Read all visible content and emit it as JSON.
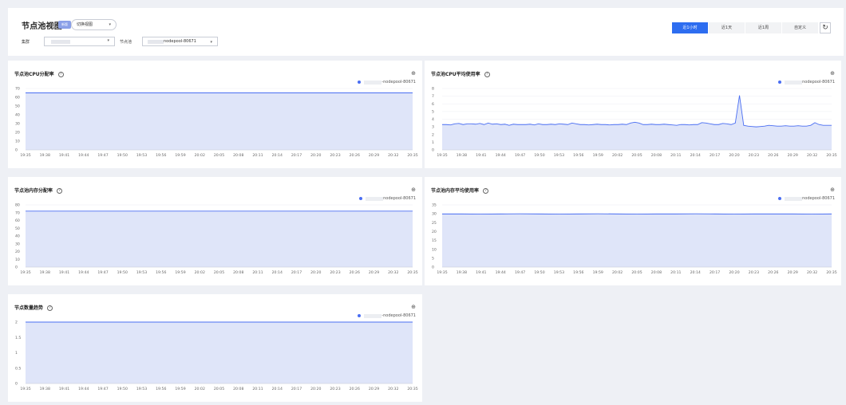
{
  "header": {
    "title": "节点池视图",
    "badge": "新版",
    "view_select": "切换视图",
    "cluster_label": "集群",
    "pool_label": "节点池",
    "pool_value": "nodepool-80671",
    "ranges": [
      "近1小时",
      "近1天",
      "近1周",
      "自定义"
    ],
    "active_range": 0,
    "refresh_icon": "refresh-icon"
  },
  "colors": {
    "accent": "#2d6df0",
    "series_line": "#4a6ef2",
    "series_fill": "#dfe5f9"
  },
  "cards": [
    {
      "title": "节点池CPU分配率",
      "legend": "-nodepool-80671"
    },
    {
      "title": "节点池CPU平均使用率",
      "legend": "nodepool-80671"
    },
    {
      "title": "节点池内存分配率",
      "legend": "nodepool-80671"
    },
    {
      "title": "节点池内存平均使用率",
      "legend": "nodepool-80671"
    },
    {
      "title": "节点数量趋势",
      "legend": "-nodepool-80671"
    }
  ],
  "chart_data": [
    {
      "type": "area",
      "title": "节点池CPU分配率",
      "x": [
        "19:35",
        "19:38",
        "19:41",
        "19:44",
        "19:47",
        "19:50",
        "19:53",
        "19:56",
        "19:59",
        "20:02",
        "20:05",
        "20:08",
        "20:11",
        "20:14",
        "20:17",
        "20:20",
        "20:23",
        "20:26",
        "20:29",
        "20:32",
        "20:35"
      ],
      "yticks": [
        0,
        10,
        20,
        30,
        40,
        50,
        60,
        70
      ],
      "ylim": [
        0,
        70
      ],
      "series": [
        {
          "name": "-nodepool-80671",
          "values": [
            65,
            65,
            65,
            65,
            65,
            65,
            65,
            65,
            65,
            65,
            65,
            65,
            65,
            65,
            65,
            65,
            65,
            65,
            65,
            65,
            65
          ]
        }
      ]
    },
    {
      "type": "area",
      "title": "节点池CPU平均使用率",
      "x": [
        "19:35",
        "19:38",
        "19:41",
        "19:44",
        "19:47",
        "19:50",
        "19:53",
        "19:56",
        "19:59",
        "20:02",
        "20:05",
        "20:08",
        "20:11",
        "20:14",
        "20:17",
        "20:20",
        "20:23",
        "20:26",
        "20:29",
        "20:32",
        "20:35"
      ],
      "yticks": [
        0,
        1,
        2,
        3,
        4,
        5,
        6,
        7,
        8
      ],
      "ylim": [
        0,
        8
      ],
      "series": [
        {
          "name": "nodepool-80671",
          "values": [
            3.3,
            3.3,
            3.25,
            3.4,
            3.45,
            3.3,
            3.4,
            3.4,
            3.35,
            3.45,
            3.3,
            3.5,
            3.35,
            3.4,
            3.3,
            3.35,
            3.2,
            3.35,
            3.3,
            3.3,
            3.3,
            3.35,
            3.25,
            3.4,
            3.3,
            3.3,
            3.35,
            3.3,
            3.4,
            3.35,
            3.3,
            3.5,
            3.4,
            3.3,
            3.3,
            3.25,
            3.3,
            3.35,
            3.3,
            3.3,
            3.25,
            3.3,
            3.3,
            3.35,
            3.3,
            3.5,
            3.6,
            3.5,
            3.3,
            3.3,
            3.35,
            3.3,
            3.3,
            3.35,
            3.3,
            3.25,
            3.2,
            3.3,
            3.3,
            3.25,
            3.3,
            3.3,
            3.55,
            3.5,
            3.4,
            3.3,
            3.3,
            3.45,
            3.4,
            3.3,
            3.5,
            7.1,
            3.2,
            3.1,
            3.05,
            3.0,
            3.05,
            3.1,
            3.2,
            3.15,
            3.1,
            3.1,
            3.15,
            3.1,
            3.1,
            3.15,
            3.1,
            3.1,
            3.2,
            3.55,
            3.3,
            3.2,
            3.2,
            3.2
          ]
        }
      ]
    },
    {
      "type": "area",
      "title": "节点池内存分配率",
      "x": [
        "19:35",
        "19:38",
        "19:41",
        "19:44",
        "19:47",
        "19:50",
        "19:53",
        "19:56",
        "19:59",
        "20:02",
        "20:05",
        "20:08",
        "20:11",
        "20:14",
        "20:17",
        "20:20",
        "20:23",
        "20:26",
        "20:29",
        "20:32",
        "20:35"
      ],
      "yticks": [
        0,
        10,
        20,
        30,
        40,
        50,
        60,
        70,
        80
      ],
      "ylim": [
        0,
        80
      ],
      "series": [
        {
          "name": "nodepool-80671",
          "values": [
            72,
            72,
            72,
            72,
            72,
            72,
            72,
            72,
            72,
            72,
            72,
            72,
            72,
            72,
            72,
            72,
            72,
            72,
            72,
            72,
            72
          ]
        }
      ]
    },
    {
      "type": "area",
      "title": "节点池内存平均使用率",
      "x": [
        "19:35",
        "19:38",
        "19:41",
        "19:44",
        "19:47",
        "19:50",
        "19:53",
        "19:56",
        "19:59",
        "20:02",
        "20:05",
        "20:08",
        "20:11",
        "20:14",
        "20:17",
        "20:20",
        "20:23",
        "20:26",
        "20:29",
        "20:32",
        "20:35"
      ],
      "yticks": [
        0,
        5,
        10,
        15,
        20,
        25,
        30,
        35
      ],
      "ylim": [
        0,
        35
      ],
      "series": [
        {
          "name": "nodepool-80671",
          "values": [
            29.9,
            29.9,
            29.8,
            29.9,
            30.0,
            29.9,
            29.8,
            29.9,
            30.0,
            29.9,
            29.8,
            29.9,
            29.9,
            30.0,
            29.9,
            29.8,
            29.9,
            29.9,
            29.9,
            29.8,
            29.9
          ]
        }
      ]
    },
    {
      "type": "area",
      "title": "节点数量趋势",
      "x": [
        "19:35",
        "19:38",
        "19:41",
        "19:44",
        "19:47",
        "19:50",
        "19:53",
        "19:56",
        "19:59",
        "20:02",
        "20:05",
        "20:08",
        "20:11",
        "20:14",
        "20:17",
        "20:20",
        "20:23",
        "20:26",
        "20:29",
        "20:32",
        "20:35"
      ],
      "yticks": [
        0,
        0.5,
        1,
        1.5,
        2
      ],
      "ylim": [
        0,
        2
      ],
      "series": [
        {
          "name": "-nodepool-80671",
          "values": [
            2,
            2,
            2,
            2,
            2,
            2,
            2,
            2,
            2,
            2,
            2,
            2,
            2,
            2,
            2,
            2,
            2,
            2,
            2,
            2,
            2
          ]
        }
      ]
    }
  ]
}
